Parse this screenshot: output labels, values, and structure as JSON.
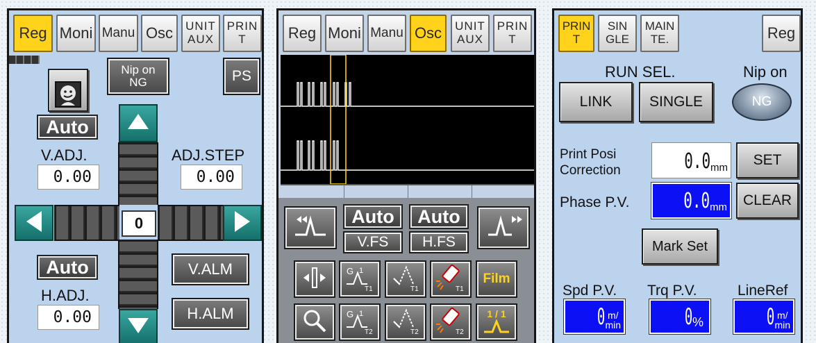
{
  "panel1": {
    "tabs": [
      "Reg",
      "Moni",
      "Manu",
      "Osc",
      "UNIT\nAUX",
      "PRIN\nT"
    ],
    "nip_button": "Nip on\nNG",
    "ps_button": "PS",
    "auto_top": "Auto",
    "v_adj_label": "V.ADJ.",
    "v_adj_value": "0.00",
    "adj_step_label": "ADJ.STEP",
    "adj_step_value": "0.00",
    "center_value": "0",
    "auto_bottom": "Auto",
    "h_adj_label": "H.ADJ.",
    "h_adj_value": "0.00",
    "v_alm_button": "V.ALM",
    "h_alm_button": "H.ALM"
  },
  "panel2": {
    "tabs": [
      "Reg",
      "Moni",
      "Manu",
      "Osc",
      "UNIT\nAUX",
      "PRIN\nT"
    ],
    "auto_v": "Auto",
    "vfs_label": "V.FS",
    "auto_h": "Auto",
    "hfs_label": "H.FS",
    "film_label": "Film",
    "t1": "T1",
    "t2": "T2",
    "ratio_label": "1 / 1"
  },
  "panel3": {
    "tabs": [
      "PRIN\nT",
      "SIN\nGLE",
      "MAIN\nTE."
    ],
    "reg_button": "Reg",
    "run_sel_label": "RUN SEL.",
    "nip_on_label": "Nip on",
    "ng_label": "NG",
    "link_button": "LINK",
    "single_button": "SINGLE",
    "print_posi_label": "Print Posi\nCorrection",
    "print_posi_value": "0.0",
    "print_posi_unit": "mm",
    "set_button": "SET",
    "phase_label": "Phase P.V.",
    "phase_value": "0.0",
    "phase_unit": "mm",
    "clear_button": "CLEAR",
    "mark_set_button": "Mark Set",
    "spd_label": "Spd P.V.",
    "spd_value": "0",
    "spd_unit": "m/\nmin",
    "trq_label": "Trq P.V.",
    "trq_value": "0",
    "trq_unit": "%",
    "lineref_label": "LineRef",
    "lineref_value": "0",
    "lineref_unit": "m/\nmin"
  },
  "colors": {
    "active_tab": "#ffd21c",
    "panel_bg": "#bcd3ee",
    "blue_value": "#0c10f5",
    "teal_arrow": "#1f8c86"
  }
}
